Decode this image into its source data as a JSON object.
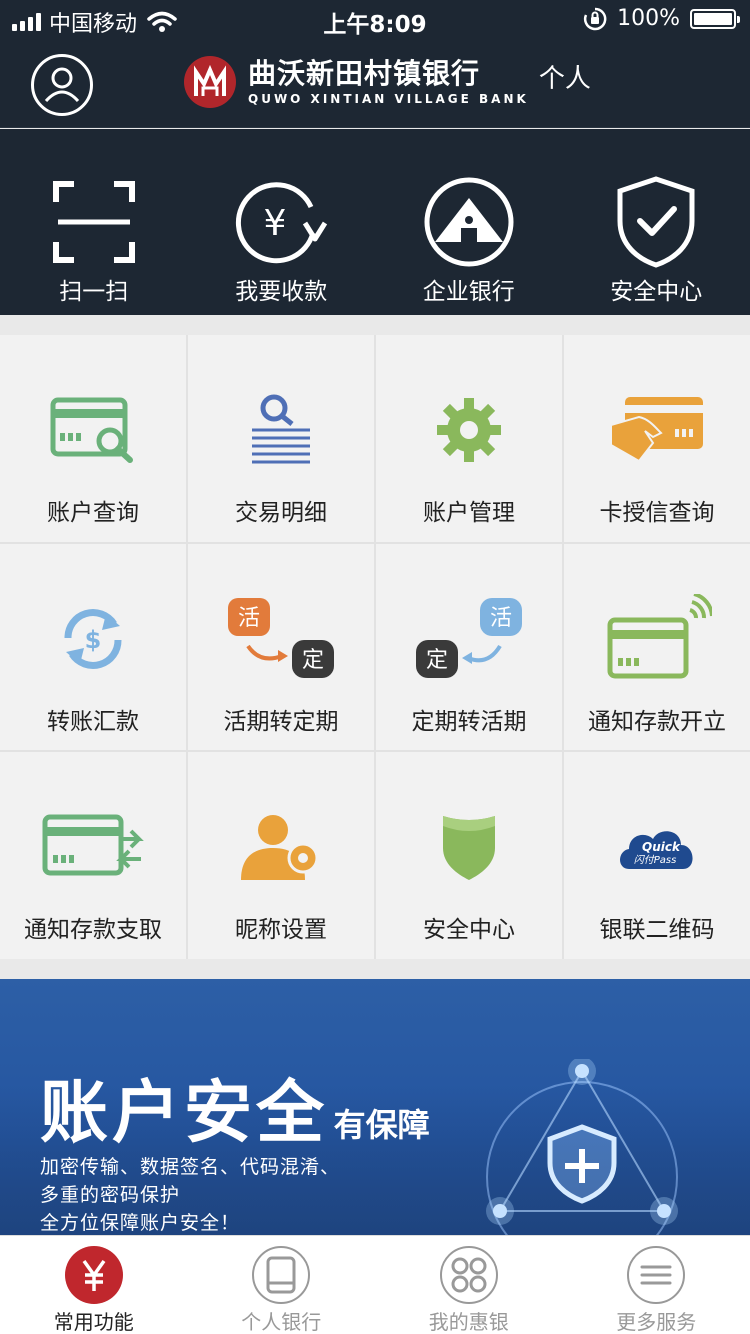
{
  "status_bar": {
    "carrier": "中国移动",
    "time": "上午8:09",
    "battery": "100%"
  },
  "header": {
    "bank_name_cn": "曲沃新田村镇银行",
    "bank_name_en": "QUWO XINTIAN VILLAGE BANK",
    "suffix": "个人"
  },
  "quick_actions": [
    {
      "label": "扫一扫",
      "icon": "scan-icon"
    },
    {
      "label": "我要收款",
      "icon": "receive-money-icon"
    },
    {
      "label": "企业银行",
      "icon": "enterprise-bank-icon"
    },
    {
      "label": "安全中心",
      "icon": "shield-check-icon"
    }
  ],
  "grid": [
    {
      "label": "账户查询",
      "icon": "account-query-icon"
    },
    {
      "label": "交易明细",
      "icon": "transaction-detail-icon"
    },
    {
      "label": "账户管理",
      "icon": "gear-icon"
    },
    {
      "label": "卡授信查询",
      "icon": "card-credit-icon"
    },
    {
      "label": "转账汇款",
      "icon": "transfer-icon"
    },
    {
      "label": "活期转定期",
      "icon": "current-to-fixed-icon",
      "badge_a": "活",
      "badge_b": "定"
    },
    {
      "label": "定期转活期",
      "icon": "fixed-to-current-icon",
      "badge_a": "定",
      "badge_b": "活"
    },
    {
      "label": "通知存款开立",
      "icon": "notice-deposit-open-icon"
    },
    {
      "label": "通知存款支取",
      "icon": "notice-deposit-withdraw-icon"
    },
    {
      "label": "昵称设置",
      "icon": "nickname-settings-icon"
    },
    {
      "label": "安全中心",
      "icon": "security-shield-icon"
    },
    {
      "label": "银联二维码",
      "icon": "quickpass-icon",
      "logo_text_a": "Quick",
      "logo_text_b": "闪付Pass"
    }
  ],
  "banner": {
    "title_big": "账户安全",
    "title_small": "有保障",
    "line1": "加密传输、数据签名、代码混淆、",
    "line2": "多重的密码保护",
    "line3": "全方位保障账户安全！"
  },
  "tabbar": [
    {
      "label": "常用功能",
      "icon": "yuan-icon",
      "active": true
    },
    {
      "label": "个人银行",
      "icon": "phone-icon",
      "active": false
    },
    {
      "label": "我的惠银",
      "icon": "apps-icon",
      "active": false
    },
    {
      "label": "更多服务",
      "icon": "menu-icon",
      "active": false
    }
  ],
  "colors": {
    "header_bg": "#1d2733",
    "brand_red": "#b1262b",
    "green": "#6ab17a",
    "blue": "#4f6fb6",
    "orange": "#e9a23b",
    "banner_blue": "#2455a0"
  }
}
